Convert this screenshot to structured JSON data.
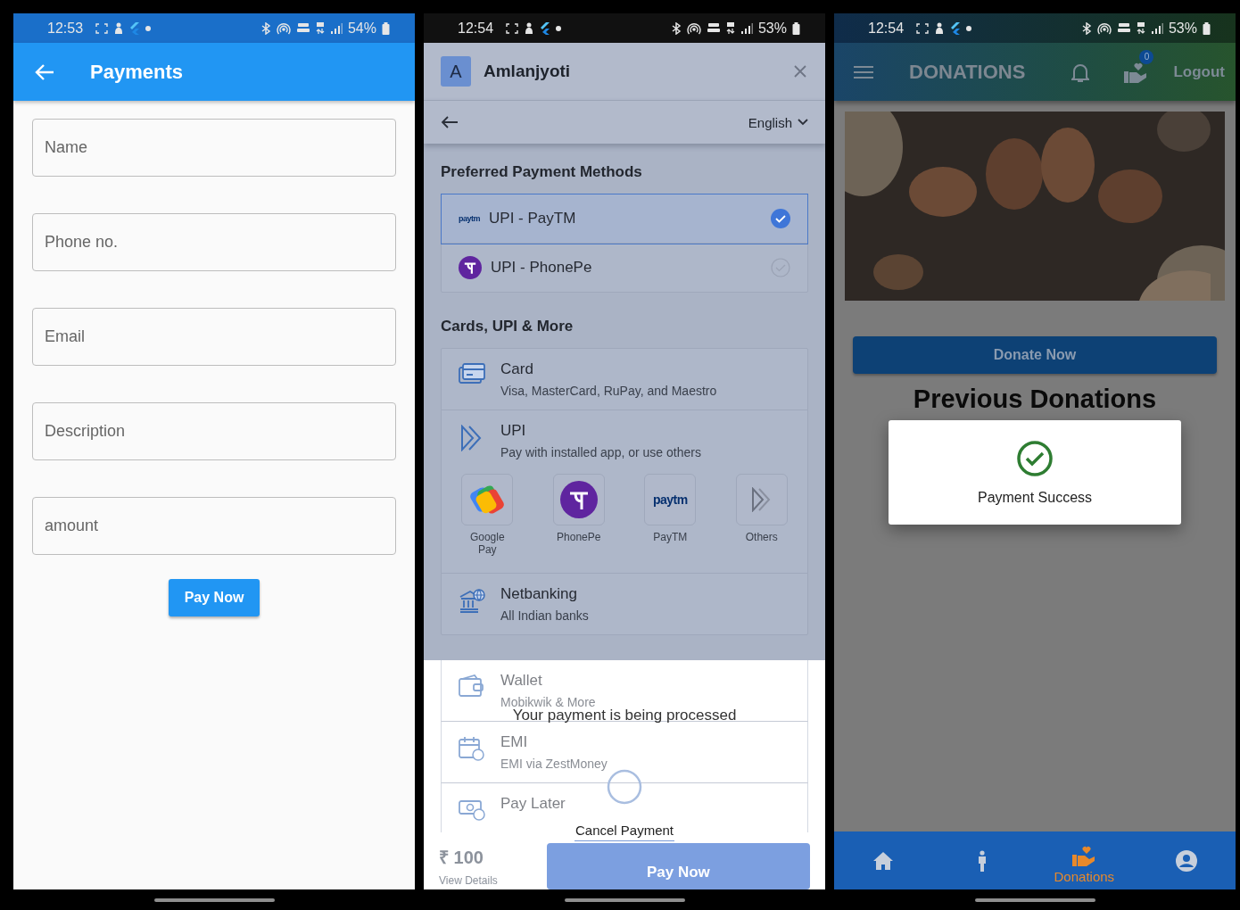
{
  "payments_screen": {
    "status_bar": {
      "time": "12:53",
      "battery": "54%"
    },
    "app_bar": {
      "title": "Payments"
    },
    "fields": [
      {
        "placeholder": "Name"
      },
      {
        "placeholder": "Phone no."
      },
      {
        "placeholder": "Email"
      },
      {
        "placeholder": "Description"
      },
      {
        "placeholder": "amount"
      }
    ],
    "submit_button": "Pay Now"
  },
  "checkout_screen": {
    "status_bar": {
      "time": "12:54",
      "battery": "53%"
    },
    "header": {
      "avatar": "A",
      "merchant": "Amlanjyoti",
      "language": "English"
    },
    "preferred_methods": {
      "title": "Preferred Payment Methods",
      "items": [
        {
          "kind": "paytm",
          "logo_text": "paytm",
          "label": "UPI - PayTM",
          "selected": true
        },
        {
          "kind": "phonepe",
          "label": "UPI - PhonePe",
          "selected": false
        }
      ]
    },
    "more_methods": {
      "title": "Cards, UPI & More",
      "items": [
        {
          "kind": "card",
          "title": "Card",
          "subtitle": "Visa, MasterCard, RuPay, and Maestro"
        },
        {
          "kind": "upi",
          "title": "UPI",
          "subtitle": "Pay with installed app, or use others",
          "apps": [
            {
              "kind": "gpay",
              "label": "Google Pay"
            },
            {
              "kind": "phonepe",
              "label": "PhonePe"
            },
            {
              "kind": "paytm",
              "logo_text": "paytm",
              "label": "PayTM"
            },
            {
              "kind": "others",
              "label": "Others"
            }
          ]
        },
        {
          "kind": "netbanking",
          "title": "Netbanking",
          "subtitle": "All Indian banks"
        }
      ]
    },
    "faded_methods": [
      {
        "kind": "wallet",
        "title": "Wallet",
        "subtitle": "Mobikwik & More"
      },
      {
        "kind": "emi",
        "title": "EMI",
        "subtitle": "EMI via ZestMoney"
      },
      {
        "kind": "paylater",
        "title": "Pay Later"
      }
    ],
    "processing": {
      "message": "Your payment is being processed",
      "cancel_link": "Cancel Payment"
    },
    "footer": {
      "amount": "₹ 100",
      "details_link": "View Details",
      "pay_button": "Pay Now"
    }
  },
  "donations_screen": {
    "status_bar": {
      "time": "12:54",
      "battery": "53%"
    },
    "app_bar": {
      "title": "DONATIONS",
      "badge": "0",
      "logout": "Logout"
    },
    "donate_button": "Donate Now",
    "section_title": "Previous Donations",
    "dialog": {
      "message": "Payment Success"
    },
    "nav": [
      {
        "kind": "home",
        "selected": false
      },
      {
        "kind": "person",
        "selected": false
      },
      {
        "kind": "donations",
        "label": "Donations",
        "selected": true
      },
      {
        "kind": "profile",
        "selected": false
      }
    ]
  }
}
